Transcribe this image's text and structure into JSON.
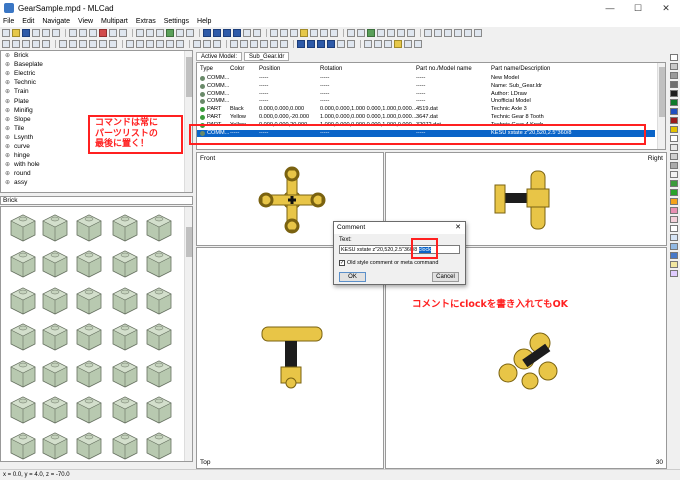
{
  "window": {
    "title": "GearSample.mpd - MLCad",
    "minimize": "—",
    "maximize": "☐",
    "close": "✕"
  },
  "menu": [
    "File",
    "Edit",
    "Navigate",
    "View",
    "Multipart",
    "Extras",
    "Settings",
    "Help"
  ],
  "tree": {
    "items": [
      "Brick",
      "Baseplate",
      "Electric",
      "Technic",
      "Train",
      "Plate",
      "Minifig",
      "Slope",
      "Tile",
      "Lsynth",
      "curve",
      "hinge",
      "with hole",
      "round",
      "assy"
    ]
  },
  "parts": {
    "category": "Brick"
  },
  "tabs": {
    "active": "Active Model:",
    "model": "Sub_Gear.ldr"
  },
  "list": {
    "headers": [
      "Type",
      "Color",
      "Position",
      "Rotation",
      "Part no./Model name",
      "Part name/Description"
    ],
    "rows": [
      [
        "COMM...",
        "",
        "-----",
        "-----",
        "-----",
        "New Model"
      ],
      [
        "COMM...",
        "",
        "-----",
        "-----",
        "-----",
        "Name: Sub_Gear.ldr"
      ],
      [
        "COMM...",
        "",
        "-----",
        "-----",
        "-----",
        "Author: LDraw"
      ],
      [
        "COMM...",
        "",
        "-----",
        "-----",
        "-----",
        "Unofficial Model"
      ],
      [
        "PART",
        "Black",
        "0.000,0.000,0.000",
        "0.000,0.000,1.000 0.000,1.000,0.000...",
        "4519.dat",
        "Technic Axle 3"
      ],
      [
        "PART",
        "Yellow",
        "0.000,0.000,-20.000",
        "1.000,0.000,0.000 0.000,1.000,0.000...",
        "3647.dat",
        "Technic Gear 8 Tooth"
      ],
      [
        "PART",
        "Yellow",
        "0.000,0.000,20.000",
        "1.000,0.000,0.000 0.000,1.000,0.000...",
        "32072.dat",
        "Technic Gear 4 Knob"
      ],
      [
        "COMM...",
        "-----",
        "-----",
        "-----",
        "-----",
        "KESU xstate z\"20,520,2.5\"360/8"
      ]
    ]
  },
  "views": {
    "front": "Front",
    "right": "Right",
    "top": "Top",
    "zoom": "30"
  },
  "dialog": {
    "title": "Comment",
    "close": "✕",
    "text_label": "Text:",
    "text_value": "KESU xstate z\"20,520,2.5\"360/8 ",
    "text_selected": "clock",
    "checkbox_label": "Old style comment or meta command",
    "checkbox_mark": "✓",
    "ok": "OK",
    "cancel": "Cancel"
  },
  "status": "x = 0.0, y = 4.0, z = -70.0",
  "annotations": {
    "left": [
      "コマンドは常に",
      "パーツリストの",
      "最後に置く！"
    ],
    "bottom": "コメントにclockを書き入れてもOK"
  },
  "palette": [
    "#ffffff",
    "#c8c8c8",
    "#9a9a9a",
    "#6e6e6e",
    "#1e1e1e",
    "#0d7a2b",
    "#1f4fbf",
    "#9b1b1b",
    "#e3c200",
    "#ffffff",
    "#e8e8e8",
    "#cfcfcf",
    "#aaaaaa",
    "#f0f0f0",
    "#3b9a3b",
    "#29a329",
    "#f4a21a",
    "#e88fb2",
    "#f3d0d9",
    "#ffffff",
    "#d6e4f5",
    "#92b9e3",
    "#4678c8",
    "#f0e6a0",
    "#e0ccff"
  ]
}
